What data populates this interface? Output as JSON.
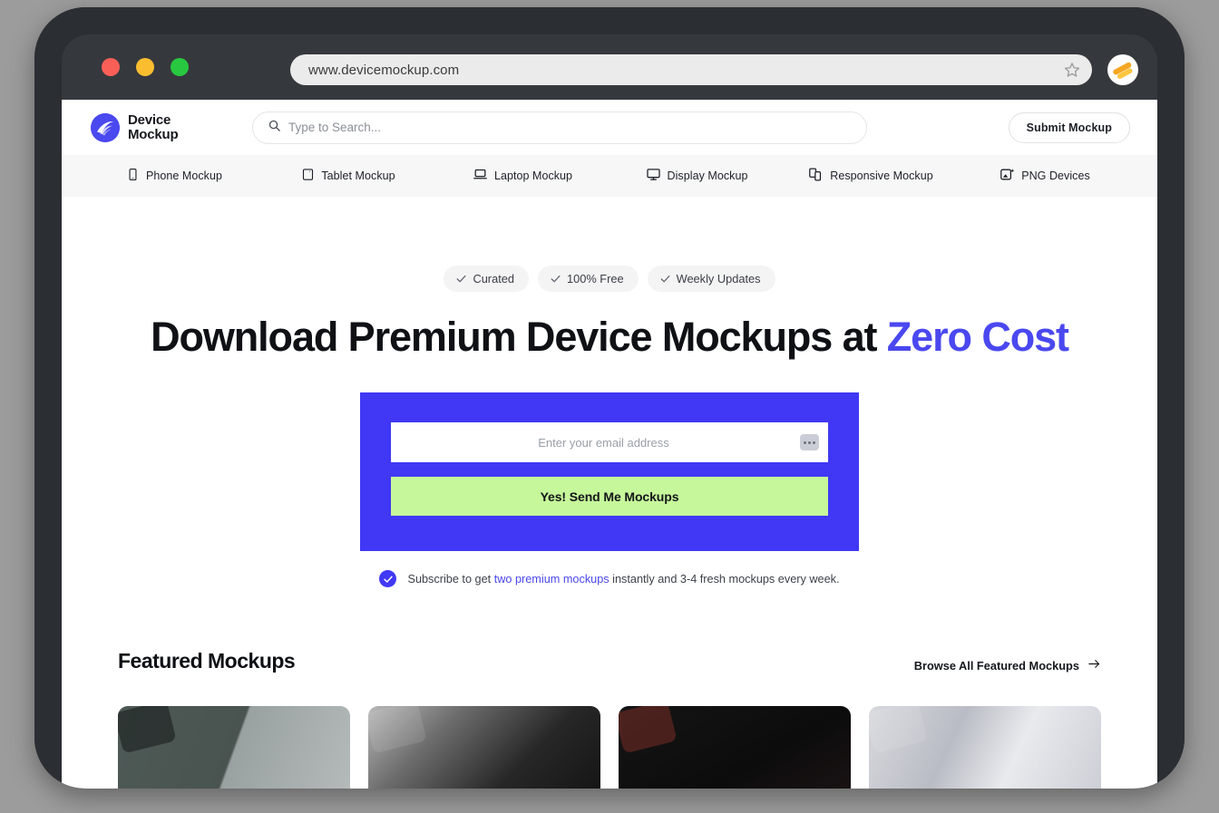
{
  "browser": {
    "url": "www.devicemockup.com",
    "traffic_lights": [
      "close",
      "minimize",
      "maximize"
    ],
    "bookmark_icon": "star-icon",
    "profile_icon": "profile-avatar-icon",
    "menu_icon": "kebab-menu-icon"
  },
  "site_header": {
    "logo": {
      "line1": "Device",
      "line2": "Mockup",
      "icon": "device-mockup-logo-icon"
    },
    "search": {
      "placeholder": "Type to Search...",
      "value": "",
      "icon": "search-icon"
    },
    "submit_label": "Submit Mockup"
  },
  "nav": {
    "items": [
      {
        "label": "Phone Mockup",
        "icon": "phone-icon"
      },
      {
        "label": "Tablet Mockup",
        "icon": "tablet-icon"
      },
      {
        "label": "Laptop Mockup",
        "icon": "laptop-icon"
      },
      {
        "label": "Display Mockup",
        "icon": "monitor-icon"
      },
      {
        "label": "Responsive Mockup",
        "icon": "responsive-devices-icon"
      },
      {
        "label": "PNG Devices",
        "icon": "image-sparkle-icon"
      }
    ]
  },
  "hero": {
    "badges": [
      {
        "label": "Curated",
        "icon": "check-icon"
      },
      {
        "label": "100% Free",
        "icon": "check-icon"
      },
      {
        "label": "Weekly Updates",
        "icon": "check-icon"
      }
    ],
    "headline_part1": "Download Premium Device Mockups at ",
    "headline_accent": "Zero Cost",
    "signup": {
      "email_placeholder": "Enter your email address",
      "email_value": "",
      "autofill_icon": "password-dots-icon",
      "cta_label": "Yes! Send Me Mockups",
      "panel_color": "#4038f4",
      "cta_color": "#c6f79b"
    },
    "subnote": {
      "icon": "check-circle-icon",
      "before": "Subscribe to get ",
      "link": "two premium mockups",
      "after": " instantly and 3-4 fresh mockups every week."
    }
  },
  "featured": {
    "title": "Featured Mockups",
    "browse_all_label": "Browse All Featured Mockups",
    "browse_all_icon": "arrow-right-icon",
    "cards": [
      {
        "name": "mockup-card-1"
      },
      {
        "name": "mockup-card-2"
      },
      {
        "name": "mockup-card-3"
      },
      {
        "name": "mockup-card-4"
      }
    ]
  },
  "theme": {
    "accent": "#4a48ef",
    "panel": "#4038f4",
    "cta": "#c6f79b",
    "frame": "#2b2f33",
    "chrome": "#35393d",
    "page_bg": "#ffffff",
    "canvas_bg": "#9c9c9c"
  }
}
